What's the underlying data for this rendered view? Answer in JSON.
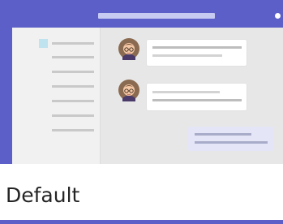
{
  "theme_option": {
    "label": "Default",
    "selected": true,
    "preview": {
      "accent_color": "#5b5fc7",
      "icons": {
        "avatar": "person-avatar-icon"
      }
    }
  }
}
